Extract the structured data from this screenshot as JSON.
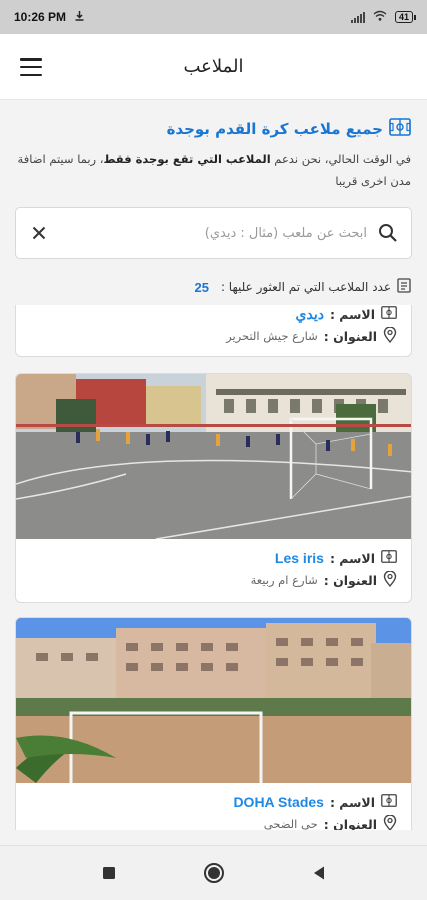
{
  "status_bar": {
    "time": "10:26 PM",
    "battery": "41"
  },
  "app_bar": {
    "title": "الملاعب"
  },
  "header": {
    "title": "جميع ملاعب كرة القدم بوجدة",
    "desc_part1": "في الوقت الحالي، نحن ندعم ",
    "desc_bold": "الملاعب التي تقع بوجدة فقط",
    "desc_part2": "، ربما سيتم اضافة مدن اخرى قريبا"
  },
  "search": {
    "placeholder": "ابحث عن ملعب (مثال : ديدي)",
    "value": ""
  },
  "results": {
    "label": "عدد الملاعب التي تم العثور عليها :",
    "count": "25"
  },
  "labels": {
    "name": "الاسم :",
    "address": "العنوان :"
  },
  "stadiums": [
    {
      "name": "ديدي",
      "address": "شارع جيش التحرير"
    },
    {
      "name": "Les iris",
      "address": "شارع ام ربيعة"
    },
    {
      "name": "DOHA Stades",
      "address": "حي الضحى"
    }
  ],
  "colors": {
    "accent": "#1976d2",
    "link": "#1e88e5"
  }
}
